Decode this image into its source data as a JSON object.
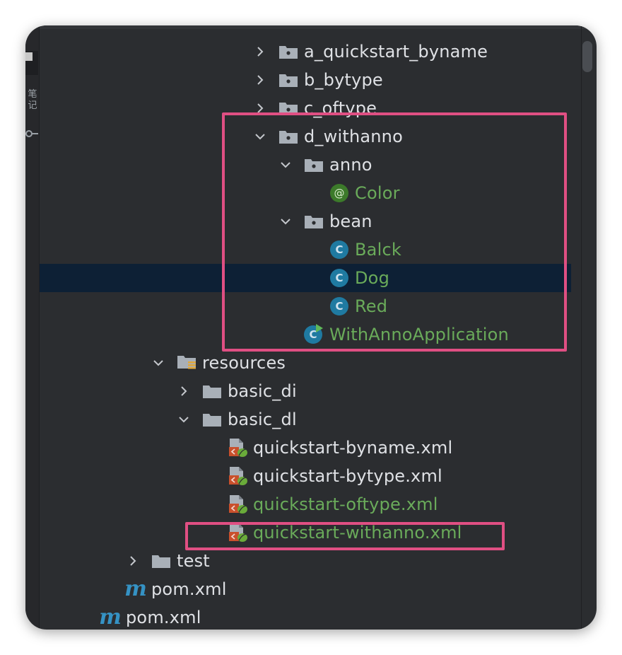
{
  "strip": {
    "glyph": "笔记"
  },
  "tree": [
    {
      "label": "a_quickstart_byname",
      "chevron": "right",
      "icon": "package-icon",
      "color": "default"
    },
    {
      "label": "b_bytype",
      "chevron": "right",
      "icon": "package-icon",
      "color": "default"
    },
    {
      "label": "c_oftype",
      "chevron": "right",
      "icon": "package-icon",
      "color": "default"
    },
    {
      "label": "d_withanno",
      "chevron": "down",
      "icon": "package-icon",
      "color": "default"
    },
    {
      "label": "anno",
      "chevron": "down",
      "icon": "package-icon",
      "color": "default"
    },
    {
      "label": "Color",
      "chevron": "none",
      "icon": "annotation-icon",
      "color": "green"
    },
    {
      "label": "bean",
      "chevron": "down",
      "icon": "package-icon",
      "color": "default"
    },
    {
      "label": "Balck",
      "chevron": "none",
      "icon": "class-icon",
      "color": "green"
    },
    {
      "label": "Dog",
      "chevron": "none",
      "icon": "class-icon",
      "color": "green"
    },
    {
      "label": "Red",
      "chevron": "none",
      "icon": "class-icon",
      "color": "green"
    },
    {
      "label": "WithAnnoApplication",
      "chevron": "none",
      "icon": "run-class-icon",
      "color": "green"
    },
    {
      "label": "resources",
      "chevron": "down",
      "icon": "resources-folder-icon",
      "color": "default"
    },
    {
      "label": "basic_di",
      "chevron": "right",
      "icon": "folder-icon",
      "color": "default"
    },
    {
      "label": "basic_dl",
      "chevron": "down",
      "icon": "folder-icon",
      "color": "default"
    },
    {
      "label": "quickstart-byname.xml",
      "chevron": "none",
      "icon": "spring-xml-icon",
      "color": "default"
    },
    {
      "label": "quickstart-bytype.xml",
      "chevron": "none",
      "icon": "spring-xml-icon",
      "color": "default"
    },
    {
      "label": "quickstart-oftype.xml",
      "chevron": "none",
      "icon": "spring-xml-icon",
      "color": "green"
    },
    {
      "label": "quickstart-withanno.xml",
      "chevron": "none",
      "icon": "spring-xml-icon",
      "color": "green"
    },
    {
      "label": "test",
      "chevron": "right",
      "icon": "folder-icon",
      "color": "default"
    },
    {
      "label": "pom.xml",
      "chevron": "none",
      "icon": "maven-icon",
      "color": "default"
    },
    {
      "label": "pom.xml",
      "chevron": "none",
      "icon": "maven-icon",
      "color": "default"
    }
  ],
  "selected_row": "Dog",
  "colors": {
    "background": "#2b2d30",
    "text": "#dfe1e5",
    "vcs_added": "#6aab5a",
    "selection": "#0d2035",
    "highlight_box": "#e04f83"
  }
}
